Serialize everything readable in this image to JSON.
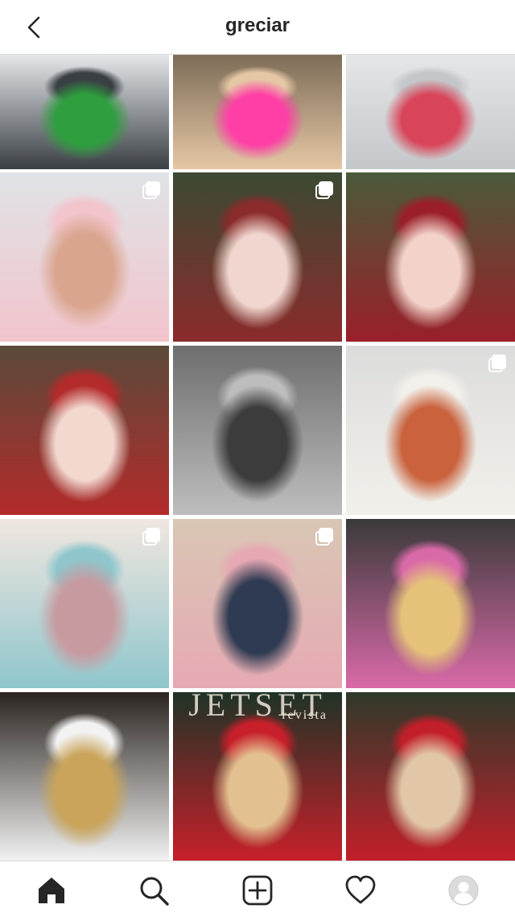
{
  "header": {
    "title": "greciar",
    "back_icon": "chevron-left-icon"
  },
  "grid": {
    "posts": [
      {
        "id": "post-1",
        "multi": false,
        "colors": [
          "#e8ecef",
          "#3a3f44",
          "#2e9e3e"
        ],
        "desc": "kids-on-steps-green-shirt"
      },
      {
        "id": "post-2",
        "multi": false,
        "colors": [
          "#7a6a55",
          "#e6c7a5",
          "#ff3fa6"
        ],
        "desc": "fitness-pink-top"
      },
      {
        "id": "post-3",
        "multi": false,
        "colors": [
          "#e5e7e8",
          "#c4c7c9",
          "#d8455a"
        ],
        "desc": "child-sitting-pink-dress"
      },
      {
        "id": "post-4",
        "multi": true,
        "colors": [
          "#dfe3e6",
          "#f2c4cc",
          "#d9a58e"
        ],
        "desc": "baby-pink-stripes"
      },
      {
        "id": "post-5",
        "multi": true,
        "colors": [
          "#3b4a33",
          "#8b2b2b",
          "#f0d6ce"
        ],
        "desc": "sisters-red-bow"
      },
      {
        "id": "post-6",
        "multi": false,
        "colors": [
          "#4a5b3a",
          "#9a1f2a",
          "#f3d2c9"
        ],
        "desc": "sisters-picnic"
      },
      {
        "id": "post-7",
        "multi": false,
        "colors": [
          "#5a4a3a",
          "#b32b2b",
          "#f3d8d0"
        ],
        "desc": "girl-arms-open"
      },
      {
        "id": "post-8",
        "multi": false,
        "colors": [
          "#6e6e6e",
          "#bdbdbd",
          "#3c3c3c"
        ],
        "desc": "fitness-bw"
      },
      {
        "id": "post-9",
        "multi": true,
        "colors": [
          "#dcdcdc",
          "#f2f0ea",
          "#c9623d"
        ],
        "desc": "sisters-sweaters"
      },
      {
        "id": "post-10",
        "multi": true,
        "colors": [
          "#f0e6df",
          "#8fc6cc",
          "#c79aa0"
        ],
        "desc": "sisters-blue-knit"
      },
      {
        "id": "post-11",
        "multi": true,
        "colors": [
          "#d9c6b4",
          "#e6a9b3",
          "#2f3b52"
        ],
        "desc": "baby-plaid-beret"
      },
      {
        "id": "post-12",
        "multi": false,
        "colors": [
          "#3a3a3a",
          "#d96aa8",
          "#e5c17a"
        ],
        "desc": "selfie-pink-sweater"
      },
      {
        "id": "post-13",
        "multi": false,
        "colors": [
          "#2b2520",
          "#f2f2f2",
          "#c9a45a"
        ],
        "desc": "family-balloons"
      },
      {
        "id": "post-14",
        "multi": false,
        "colors": [
          "#1f3326",
          "#c8202a",
          "#e3c08f"
        ],
        "desc": "magazine-cover-red"
      },
      {
        "id": "post-15",
        "multi": false,
        "colors": [
          "#2f3a2a",
          "#c31f2a",
          "#e1c7a8"
        ],
        "desc": "mother-baby-red-cape"
      }
    ],
    "magazine_text": {
      "masthead": "JETSET",
      "subtitle": "revista"
    }
  },
  "tabbar": {
    "items": [
      {
        "name": "home-tab",
        "icon": "home-icon",
        "active": true
      },
      {
        "name": "search-tab",
        "icon": "search-icon",
        "active": false
      },
      {
        "name": "new-post-tab",
        "icon": "add-post-icon",
        "active": false
      },
      {
        "name": "activity-tab",
        "icon": "heart-icon",
        "active": false
      },
      {
        "name": "profile-tab",
        "icon": "avatar-icon",
        "active": false
      }
    ]
  },
  "colors": {
    "border": "#dbdbdb",
    "text": "#262626",
    "white": "#ffffff"
  }
}
